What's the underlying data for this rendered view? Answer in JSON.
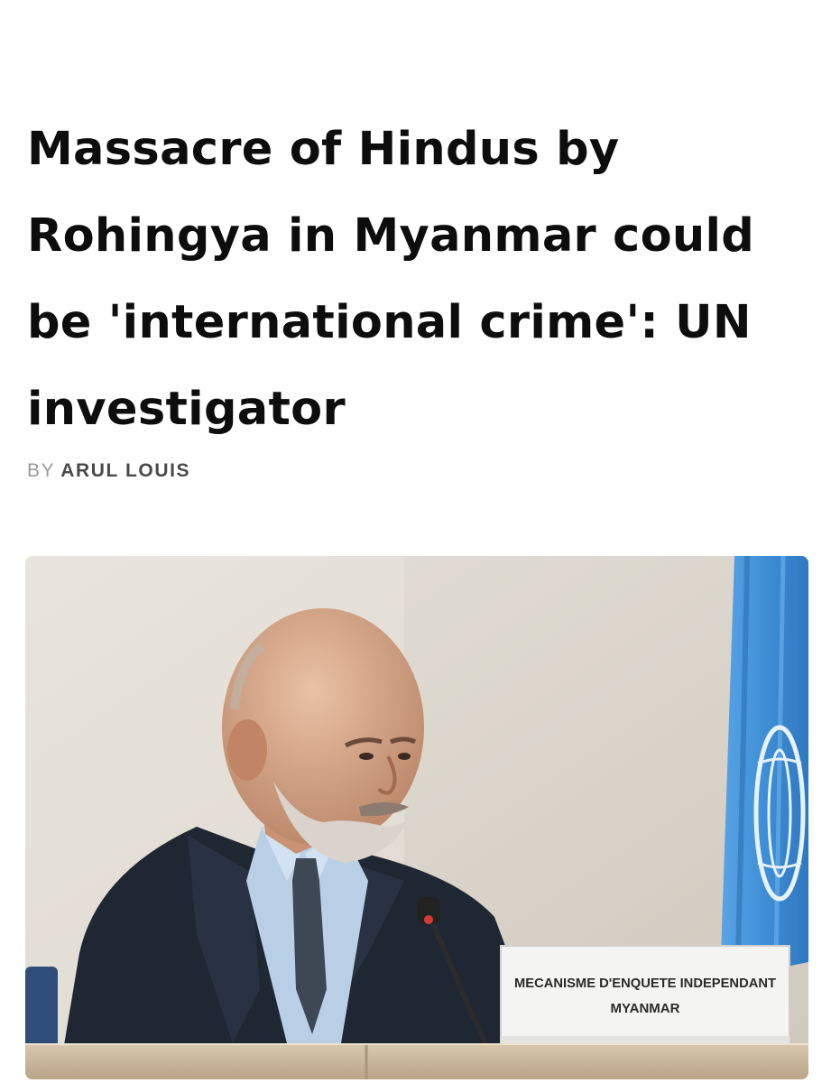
{
  "article": {
    "headline": "Massacre of Hindus by Rohingya in Myanmar could be 'international crime': UN investigator",
    "byline_prefix": "BY",
    "author": "ARUL LOUIS"
  },
  "photo": {
    "placard_line1": "MECANISME D'ENQUETE INDEPENDANT",
    "placard_line2": "MYANMAR"
  },
  "colors": {
    "headline": "#0d0d0d",
    "byline_prefix": "#9a9a9a",
    "author": "#4a4a4a",
    "un_flag_blue": "#3f8fd6"
  }
}
